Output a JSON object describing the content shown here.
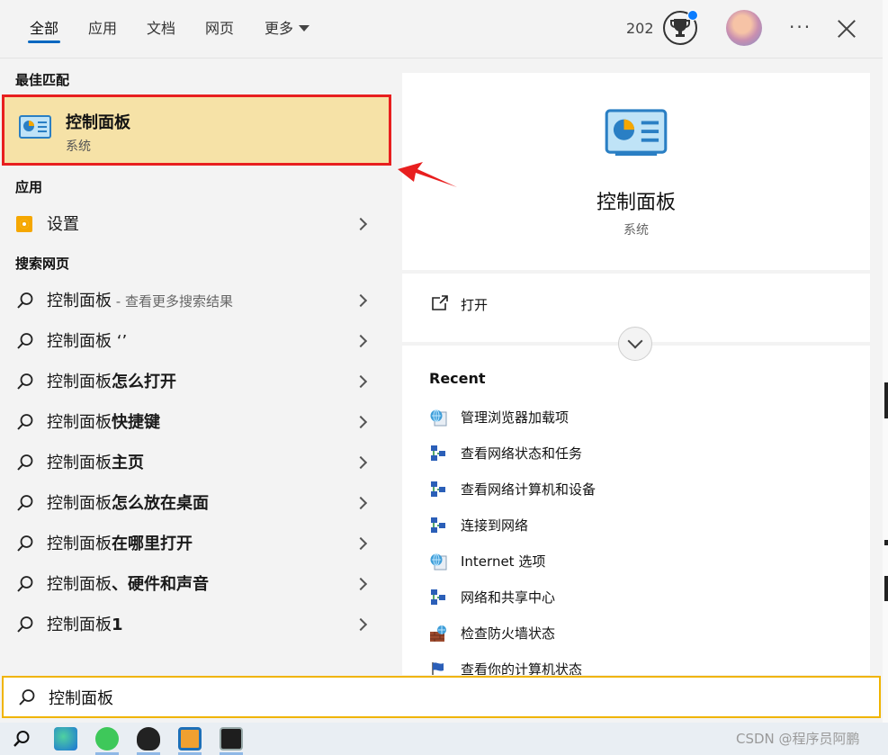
{
  "tabs": [
    {
      "label": "全部",
      "active": true
    },
    {
      "label": "应用"
    },
    {
      "label": "文档"
    },
    {
      "label": "网页"
    },
    {
      "label": "更多"
    }
  ],
  "header": {
    "points": "202"
  },
  "sections": {
    "best": "最佳匹配",
    "apps": "应用",
    "web": "搜索网页"
  },
  "best_match": {
    "title": "控制面板",
    "subtitle": "系统"
  },
  "apps": [
    {
      "label": "设置"
    }
  ],
  "web_results": [
    {
      "prefix": "控制面板",
      "bold": "",
      "hint": " - 查看更多搜索结果"
    },
    {
      "prefix": "控制面板 ‘’",
      "bold": "",
      "hint": ""
    },
    {
      "prefix": "控制面板",
      "bold": "怎么打开",
      "hint": ""
    },
    {
      "prefix": "控制面板",
      "bold": "快捷键",
      "hint": ""
    },
    {
      "prefix": "控制面板",
      "bold": "主页",
      "hint": ""
    },
    {
      "prefix": "控制面板",
      "bold": "怎么放在桌面",
      "hint": ""
    },
    {
      "prefix": "控制面板",
      "bold": "在哪里打开",
      "hint": ""
    },
    {
      "prefix": "控制面板",
      "bold": "、硬件和声音",
      "hint": ""
    },
    {
      "prefix": "控制面板",
      "bold": "1",
      "hint": ""
    }
  ],
  "preview": {
    "title": "控制面板",
    "subtitle": "系统",
    "open_label": "打开"
  },
  "recent": {
    "title": "Recent",
    "items": [
      {
        "label": "管理浏览器加载项",
        "icon": "globe-icon"
      },
      {
        "label": "查看网络状态和任务",
        "icon": "network-icon"
      },
      {
        "label": "查看网络计算机和设备",
        "icon": "network-icon"
      },
      {
        "label": "连接到网络",
        "icon": "network-icon"
      },
      {
        "label": "Internet 选项",
        "icon": "globe-icon"
      },
      {
        "label": "网络和共享中心",
        "icon": "network-icon"
      },
      {
        "label": "检查防火墙状态",
        "icon": "firewall-icon"
      },
      {
        "label": "查看你的计算机状态",
        "icon": "flag-icon"
      }
    ]
  },
  "search": {
    "value": "控制面板"
  },
  "watermark": "CSDN @程序员阿鹏",
  "colors": {
    "highlight": "#f6e2a7",
    "highlight_border": "#e81f1f",
    "search_border": "#f0b400",
    "accent": "#0067c0"
  }
}
